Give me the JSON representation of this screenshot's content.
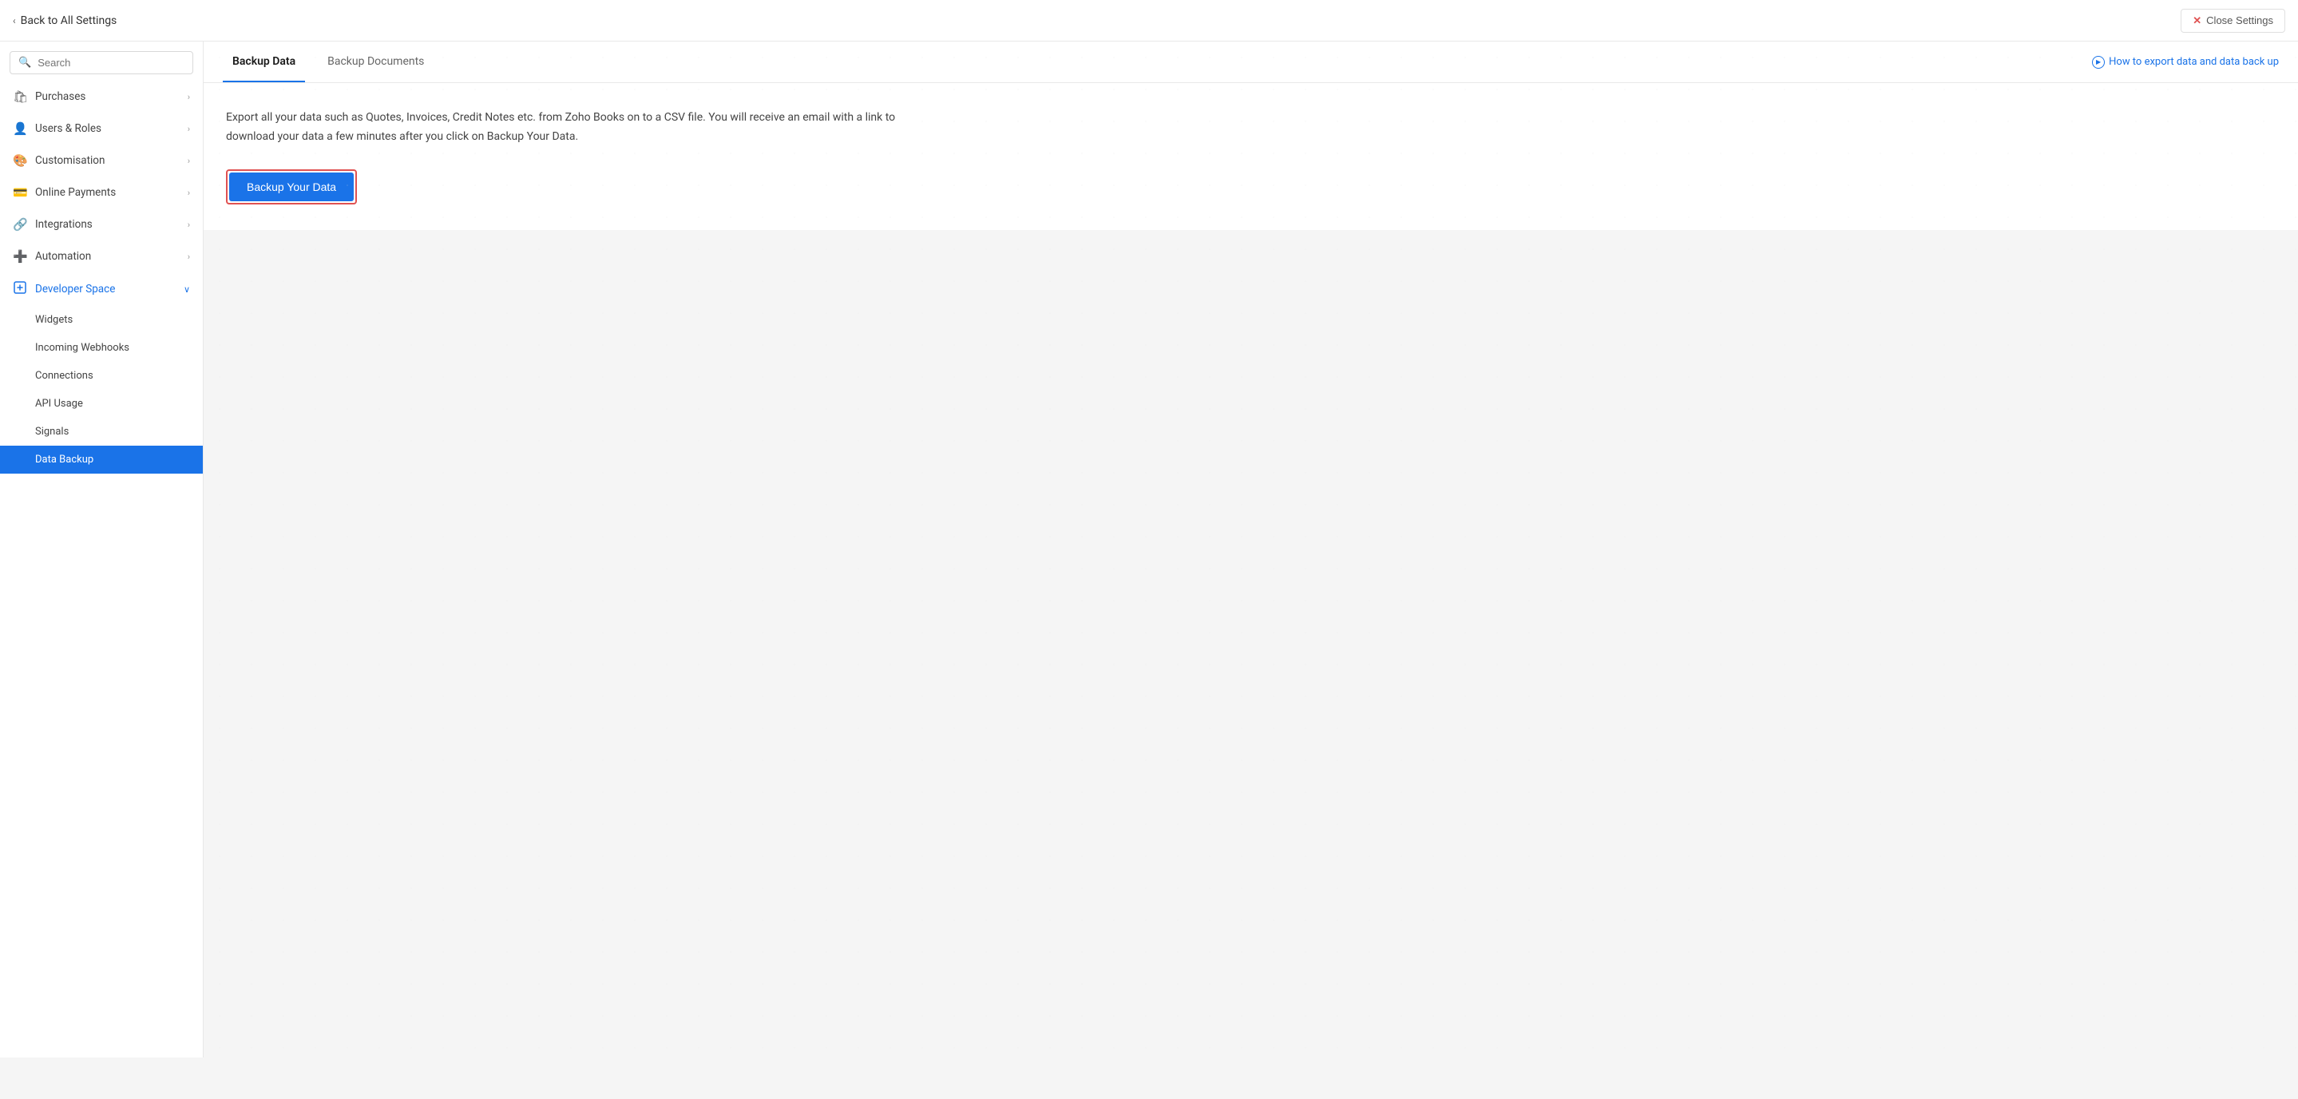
{
  "topbar": {
    "back_label": "Back to All Settings",
    "close_label": "Close Settings"
  },
  "sidebar": {
    "search_placeholder": "Search",
    "items": [
      {
        "id": "purchases",
        "label": "Purchases",
        "icon": "🛍",
        "has_chevron": true,
        "expanded": false
      },
      {
        "id": "users-roles",
        "label": "Users & Roles",
        "icon": "👤",
        "has_chevron": true,
        "expanded": false
      },
      {
        "id": "customisation",
        "label": "Customisation",
        "icon": "🎨",
        "has_chevron": true,
        "expanded": false
      },
      {
        "id": "online-payments",
        "label": "Online Payments",
        "icon": "💳",
        "has_chevron": true,
        "expanded": false
      },
      {
        "id": "integrations",
        "label": "Integrations",
        "icon": "🔗",
        "has_chevron": true,
        "expanded": false
      },
      {
        "id": "automation",
        "label": "Automation",
        "icon": "➕",
        "has_chevron": true,
        "expanded": false
      },
      {
        "id": "developer-space",
        "label": "Developer Space",
        "icon": "🔷",
        "has_chevron": false,
        "expanded": true,
        "is_blue": true
      }
    ],
    "sub_items": [
      {
        "id": "widgets",
        "label": "Widgets"
      },
      {
        "id": "incoming-webhooks",
        "label": "Incoming Webhooks"
      },
      {
        "id": "connections",
        "label": "Connections"
      },
      {
        "id": "api-usage",
        "label": "API Usage"
      },
      {
        "id": "signals",
        "label": "Signals"
      },
      {
        "id": "data-backup",
        "label": "Data Backup",
        "active": true
      }
    ]
  },
  "tabs": [
    {
      "id": "backup-data",
      "label": "Backup Data",
      "active": true
    },
    {
      "id": "backup-documents",
      "label": "Backup Documents",
      "active": false
    }
  ],
  "help_link": "How to export data and data back up",
  "content": {
    "description": "Export all your data such as Quotes, Invoices, Credit Notes etc. from Zoho Books on to a CSV file. You will receive an email with a link to download your data a few minutes after you click on Backup Your Data.",
    "backup_button_label": "Backup Your Data"
  }
}
